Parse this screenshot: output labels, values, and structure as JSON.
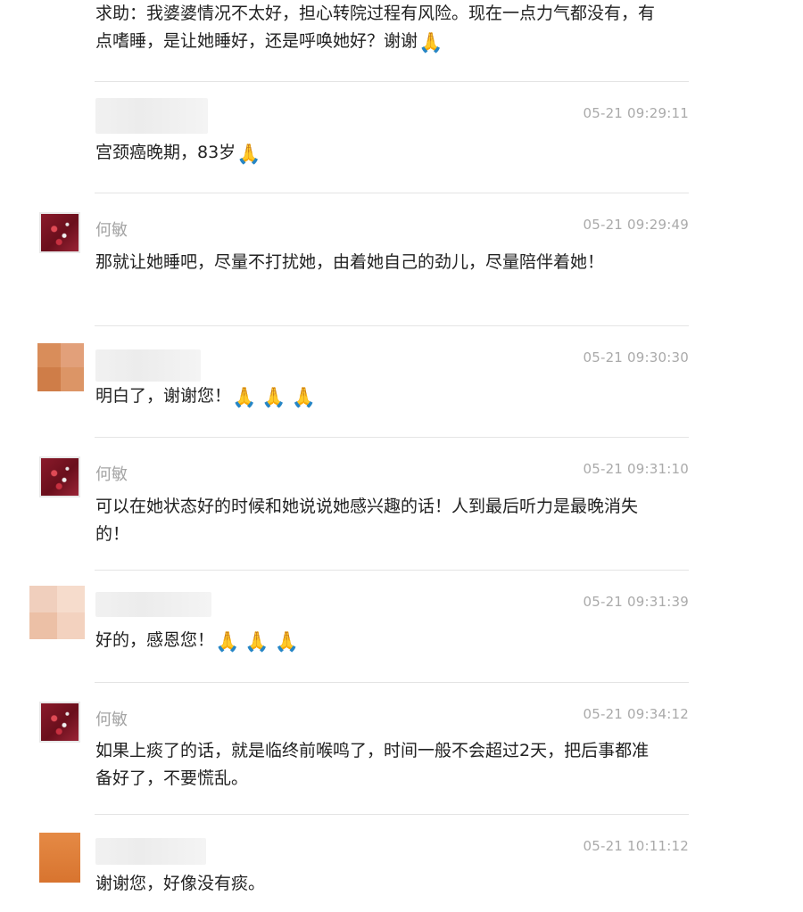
{
  "comments": [
    {
      "id": "c0",
      "author": "",
      "time": "",
      "text": "求助：我婆婆情况不太好，担心转院过程有风险。现在一点力气都没有，有点嗜睡，是让她睡好，还是呼唤她好？谢谢",
      "emoji": "🙏"
    },
    {
      "id": "c1",
      "author": "",
      "time": "05-21 09:29:11",
      "text": "宫颈癌晚期，83岁",
      "emoji": "🙏"
    },
    {
      "id": "c2",
      "author": "何敏",
      "time": "05-21 09:29:49",
      "text": "那就让她睡吧，尽量不打扰她，由着她自己的劲儿，尽量陪伴着她！",
      "emoji": ""
    },
    {
      "id": "c3",
      "author": "",
      "time": "05-21 09:30:30",
      "text": "明白了，谢谢您！",
      "emoji": "🙏🙏🙏"
    },
    {
      "id": "c4",
      "author": "何敏",
      "time": "05-21 09:31:10",
      "text": "可以在她状态好的时候和她说说她感兴趣的话！人到最后听力是最晚消失的！",
      "emoji": ""
    },
    {
      "id": "c5",
      "author": "",
      "time": "05-21 09:31:39",
      "text": "好的，感恩您！",
      "emoji": "🙏🙏🙏"
    },
    {
      "id": "c6",
      "author": "何敏",
      "time": "05-21 09:34:12",
      "text": "如果上痰了的话，就是临终前喉鸣了，时间一般不会超过2天，把后事都准备好了，不要慌乱。",
      "emoji": ""
    },
    {
      "id": "c7",
      "author": "",
      "time": "05-21 10:11:12",
      "text": "谢谢您，好像没有痰。",
      "emoji": ""
    }
  ]
}
